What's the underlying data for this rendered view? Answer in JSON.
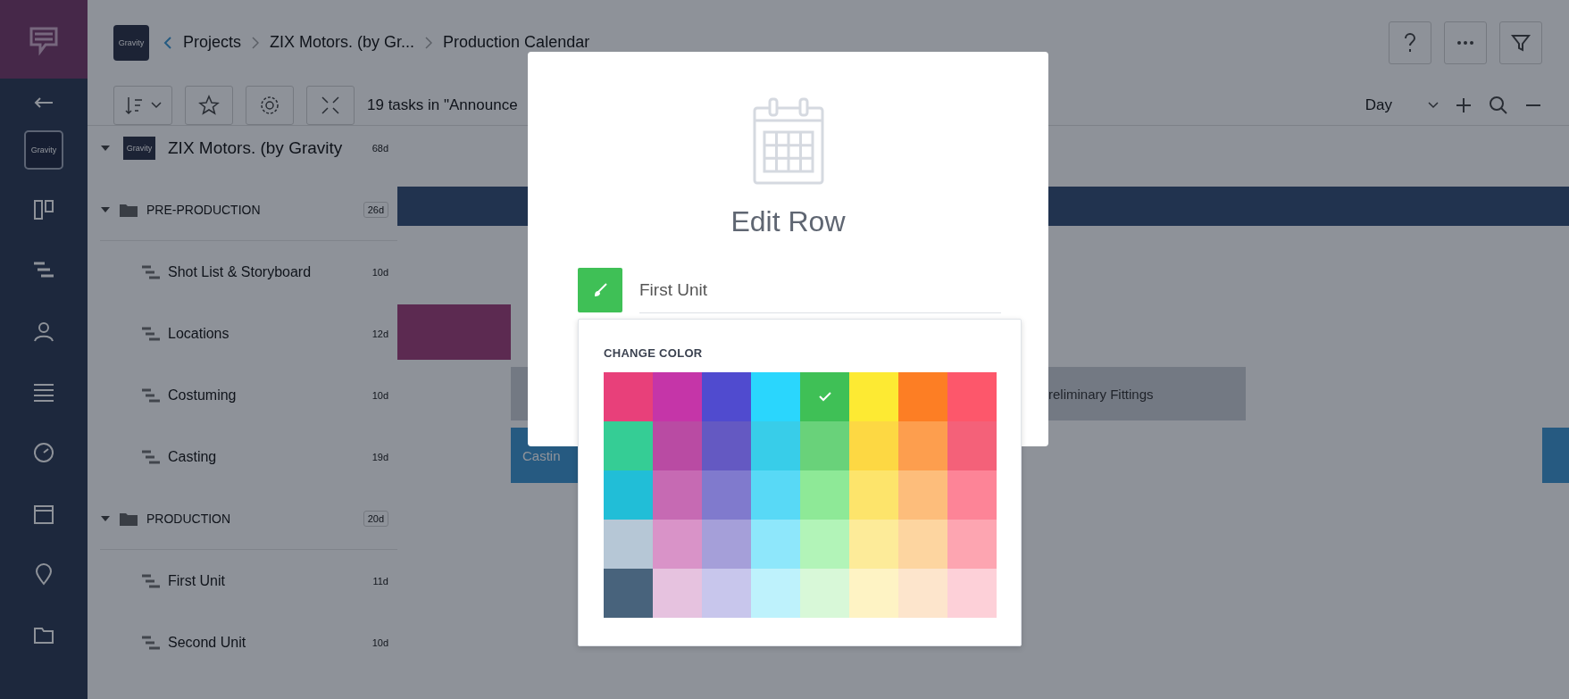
{
  "rail": {
    "workspace_label": "Gravity"
  },
  "header": {
    "logo_text": "Gravity",
    "breadcrumbs": [
      "Projects",
      "ZIX Motors. (by Gr...",
      "Production Calendar"
    ]
  },
  "toolbar": {
    "task_count": "19 tasks in \"Announce",
    "zoom_level": "Day"
  },
  "tree": {
    "root": {
      "label": "ZIX Motors. (by Gravity",
      "duration": "68d",
      "logo_text": "Gravity",
      "expanded": true
    },
    "groups": [
      {
        "label": "PRE-PRODUCTION",
        "duration": "26d",
        "expanded": true,
        "children": [
          {
            "label": "Shot List & Storyboard",
            "duration": "10d"
          },
          {
            "label": "Locations",
            "duration": "12d"
          },
          {
            "label": "Costuming",
            "duration": "10d"
          },
          {
            "label": "Casting",
            "duration": "19d"
          }
        ]
      },
      {
        "label": "PRODUCTION",
        "duration": "20d",
        "expanded": true,
        "children": [
          {
            "label": "First Unit",
            "duration": "11d"
          },
          {
            "label": "Second Unit",
            "duration": "10d"
          }
        ]
      }
    ]
  },
  "gantt": {
    "bars": [
      {
        "kind": "summary"
      },
      {
        "kind": "task"
      },
      {
        "kind": "task",
        "label": "reliminary Fittings"
      },
      {
        "kind": "task",
        "label": "Castin"
      },
      {
        "kind": "edge"
      }
    ]
  },
  "modal": {
    "title": "Edit Row",
    "name_value": "First Unit",
    "palette": {
      "title": "CHANGE COLOR",
      "swatches": [
        {
          "color": "#e8407a",
          "selected": false
        },
        {
          "color": "#c535a8",
          "selected": false
        },
        {
          "color": "#504bcf",
          "selected": false
        },
        {
          "color": "#2ad6fd",
          "selected": false
        },
        {
          "color": "#3fc056",
          "selected": true
        },
        {
          "color": "#fdea33",
          "selected": false
        },
        {
          "color": "#fd7e24",
          "selected": false
        },
        {
          "color": "#fd576b",
          "selected": false
        },
        {
          "color": "#35cd95",
          "selected": false
        },
        {
          "color": "#b94ba3",
          "selected": false
        },
        {
          "color": "#6459c2",
          "selected": false
        },
        {
          "color": "#38cde9",
          "selected": false
        },
        {
          "color": "#69d27a",
          "selected": false
        },
        {
          "color": "#fdd843",
          "selected": false
        },
        {
          "color": "#fd9e4e",
          "selected": false
        },
        {
          "color": "#f46179",
          "selected": false
        },
        {
          "color": "#21bed7",
          "selected": false
        },
        {
          "color": "#c66ab3",
          "selected": false
        },
        {
          "color": "#807acd",
          "selected": false
        },
        {
          "color": "#58d9f6",
          "selected": false
        },
        {
          "color": "#8ee997",
          "selected": false
        },
        {
          "color": "#fde46b",
          "selected": false
        },
        {
          "color": "#fdbd7b",
          "selected": false
        },
        {
          "color": "#fd8497",
          "selected": false
        },
        {
          "color": "#b6c7d6",
          "selected": false
        },
        {
          "color": "#d993c8",
          "selected": false
        },
        {
          "color": "#a59fd9",
          "selected": false
        },
        {
          "color": "#8ee7fb",
          "selected": false
        },
        {
          "color": "#b2f4b8",
          "selected": false
        },
        {
          "color": "#fdeb99",
          "selected": false
        },
        {
          "color": "#fdd5a0",
          "selected": false
        },
        {
          "color": "#fda5b1",
          "selected": false
        },
        {
          "color": "#48637c",
          "selected": false
        },
        {
          "color": "#e6c2df",
          "selected": false
        },
        {
          "color": "#c8c6ec",
          "selected": false
        },
        {
          "color": "#bef2fc",
          "selected": false
        },
        {
          "color": "#d8f8d8",
          "selected": false
        },
        {
          "color": "#fef3c4",
          "selected": false
        },
        {
          "color": "#fde5cc",
          "selected": false
        },
        {
          "color": "#fdd0d8",
          "selected": false
        }
      ]
    }
  }
}
